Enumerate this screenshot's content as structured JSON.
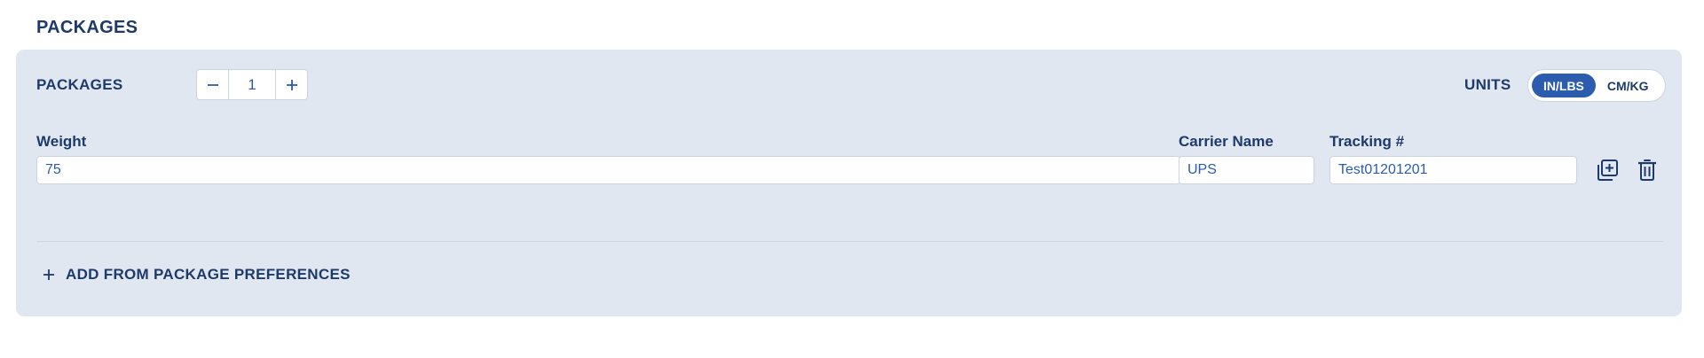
{
  "section": {
    "title": "PACKAGES"
  },
  "packages_row": {
    "label": "PACKAGES",
    "count": "1",
    "units_label": "UNITS",
    "units_options": [
      "IN/LBS",
      "CM/KG"
    ],
    "units_selected": "IN/LBS"
  },
  "package": {
    "weight_label": "Weight",
    "weight_value": "75",
    "carrier_label": "Carrier Name",
    "carrier_value": "UPS",
    "tracking_label": "Tracking #",
    "tracking_value": "Test01201201"
  },
  "actions": {
    "duplicate_icon": "copy-plus-icon",
    "delete_icon": "trash-icon",
    "add_from_preferences": "ADD FROM PACKAGE PREFERENCES"
  },
  "colors": {
    "accent": "#2b5cae",
    "text": "#1d3a6b",
    "card_bg": "#e0e7f0"
  }
}
